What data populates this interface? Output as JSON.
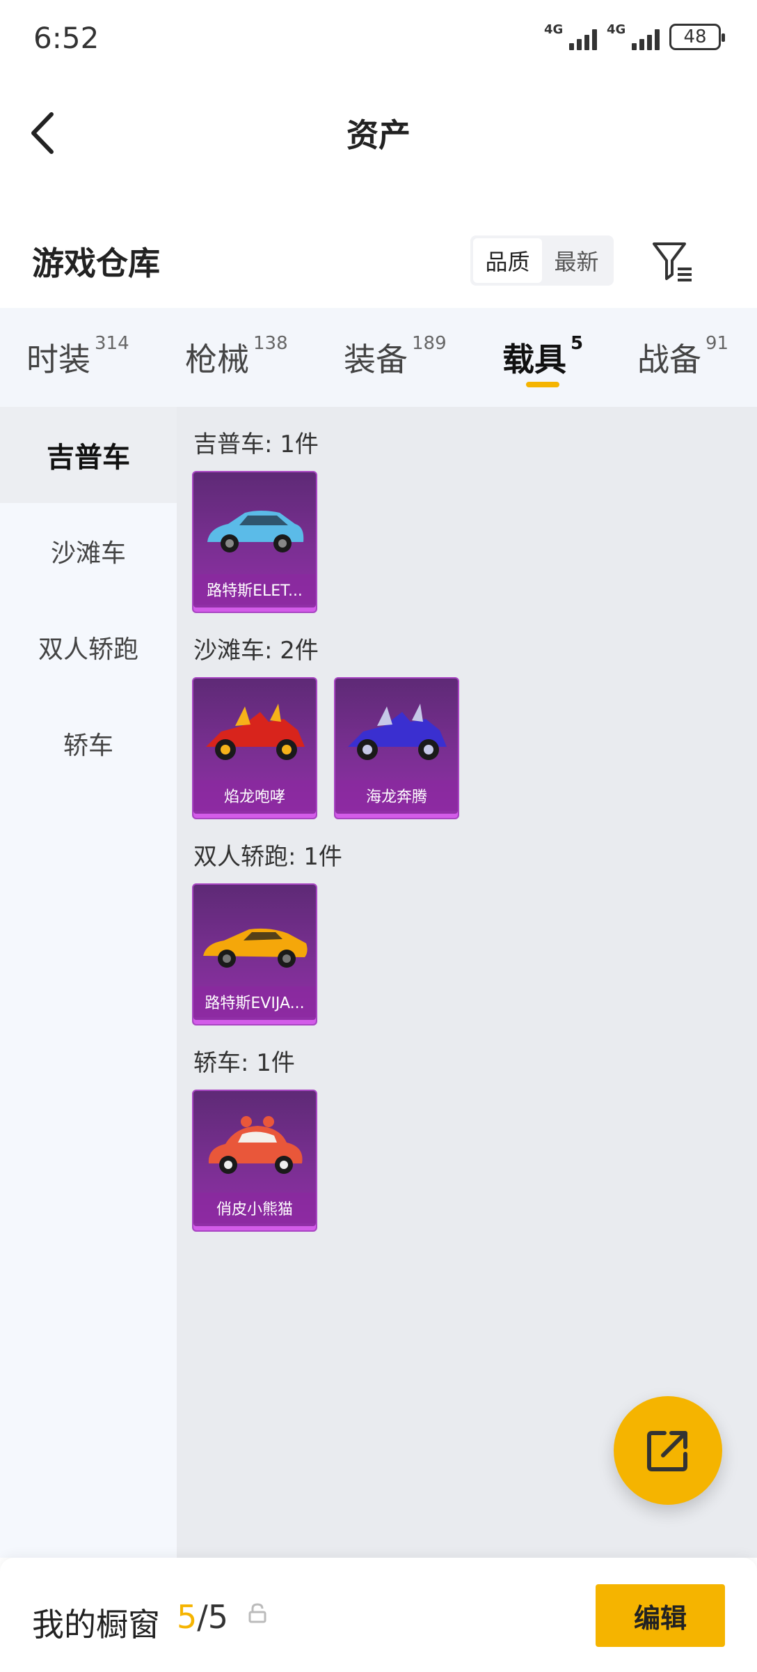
{
  "status_bar": {
    "time": "6:52",
    "network_1": "4G",
    "network_2": "4G",
    "battery": "48"
  },
  "header": {
    "title": "资产",
    "back_icon": "chevron-left-icon"
  },
  "section": {
    "title": "游戏仓库",
    "sort_options": [
      "品质",
      "最新"
    ],
    "sort_selected": "品质",
    "filter_icon": "filter-icon"
  },
  "tabs": [
    {
      "label": "时装",
      "count": "314"
    },
    {
      "label": "枪械",
      "count": "138"
    },
    {
      "label": "装备",
      "count": "189"
    },
    {
      "label": "载具",
      "count": "5"
    },
    {
      "label": "战备",
      "count": "91"
    }
  ],
  "active_tab": "载具",
  "sidebar": {
    "items": [
      "吉普车",
      "沙滩车",
      "双人轿跑",
      "轿车"
    ],
    "active": "吉普车"
  },
  "groups": [
    {
      "title": "吉普车: 1件",
      "items": [
        {
          "name": "路特斯ELET...",
          "car_color": "#5bbbe8"
        }
      ]
    },
    {
      "title": "沙滩车: 2件",
      "items": [
        {
          "name": "焰龙咆哮",
          "car_color": "#d8241c"
        },
        {
          "name": "海龙奔腾",
          "car_color": "#3a2fd0"
        }
      ]
    },
    {
      "title": "双人轿跑: 1件",
      "items": [
        {
          "name": "路特斯EVIJA...",
          "car_color": "#f5a70a"
        }
      ]
    },
    {
      "title": "轿车: 1件",
      "items": [
        {
          "name": "俏皮小熊猫",
          "car_color": "#e9573a"
        }
      ]
    }
  ],
  "fab": {
    "icon": "share-external-icon"
  },
  "bottom_bar": {
    "label": "我的橱窗",
    "current": "5",
    "separator": "/",
    "total": "5",
    "lock_icon": "lock-icon",
    "edit_label": "编辑"
  },
  "colors": {
    "accent": "#f5b400",
    "card_purple": "#7b2f93"
  }
}
